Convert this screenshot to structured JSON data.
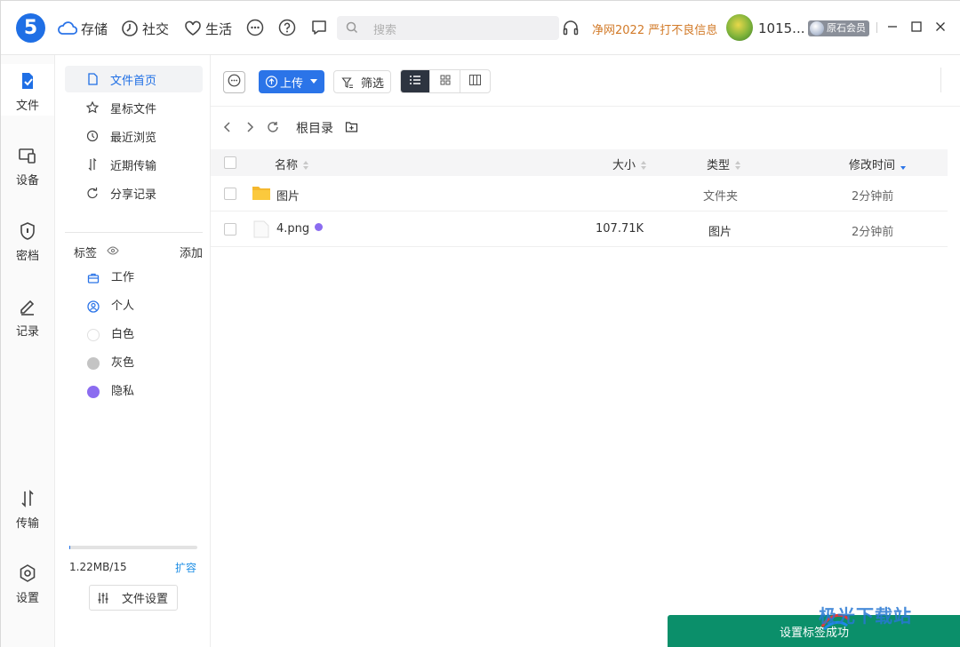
{
  "app": {
    "logo_text": "5",
    "nav": [
      {
        "label": "存储",
        "icon": "cloud-icon"
      },
      {
        "label": "社交",
        "icon": "clock-icon"
      },
      {
        "label": "生活",
        "icon": "heart-icon"
      }
    ],
    "search_placeholder": "搜索",
    "promo": "净网2022 严打不良信息",
    "username": "1015...",
    "vip_label": "原石会员"
  },
  "rail": [
    {
      "label": "文件",
      "icon": "file-icon",
      "active": true
    },
    {
      "label": "设备",
      "icon": "device-icon"
    },
    {
      "label": "密档",
      "icon": "shield-icon"
    },
    {
      "label": "记录",
      "icon": "pen-icon"
    },
    {
      "label": "传输",
      "icon": "transfer-icon"
    },
    {
      "label": "设置",
      "icon": "settings-icon"
    }
  ],
  "sidebar": {
    "items": [
      {
        "label": "文件首页",
        "icon": "file-home-icon",
        "active": true
      },
      {
        "label": "星标文件",
        "icon": "star-icon"
      },
      {
        "label": "最近浏览",
        "icon": "history-icon"
      },
      {
        "label": "近期传输",
        "icon": "transfer-icon"
      },
      {
        "label": "分享记录",
        "icon": "share-icon"
      }
    ],
    "tags_title": "标签",
    "tags_add": "添加",
    "tags": [
      {
        "label": "工作",
        "color": "#2b74e8",
        "icon": "briefcase-icon"
      },
      {
        "label": "个人",
        "color": "#2b74e8",
        "icon": "person-icon"
      },
      {
        "label": "白色",
        "color": "#ffffff"
      },
      {
        "label": "灰色",
        "color": "#c4c4c4"
      },
      {
        "label": "隐私",
        "color": "#8b6cf0"
      }
    ],
    "storage_used": 0.01,
    "storage_text": "1.22MB/15",
    "expand": "扩容",
    "file_settings": "文件设置"
  },
  "toolbar": {
    "upload": "上传",
    "filter": "筛选"
  },
  "path": {
    "root": "根目录"
  },
  "table": {
    "headers": {
      "name": "名称",
      "size": "大小",
      "type": "类型",
      "modified": "修改时间"
    },
    "rows": [
      {
        "name": "图片",
        "size": "",
        "type": "文件夹",
        "modified": "2分钟前",
        "kind": "folder"
      },
      {
        "name": "4.png",
        "size": "107.71K",
        "type": "图片",
        "modified": "2分钟前",
        "kind": "image",
        "tag_color": "#8b6cf0"
      }
    ]
  },
  "toast": "设置标签成功",
  "watermark": "极光下载站"
}
